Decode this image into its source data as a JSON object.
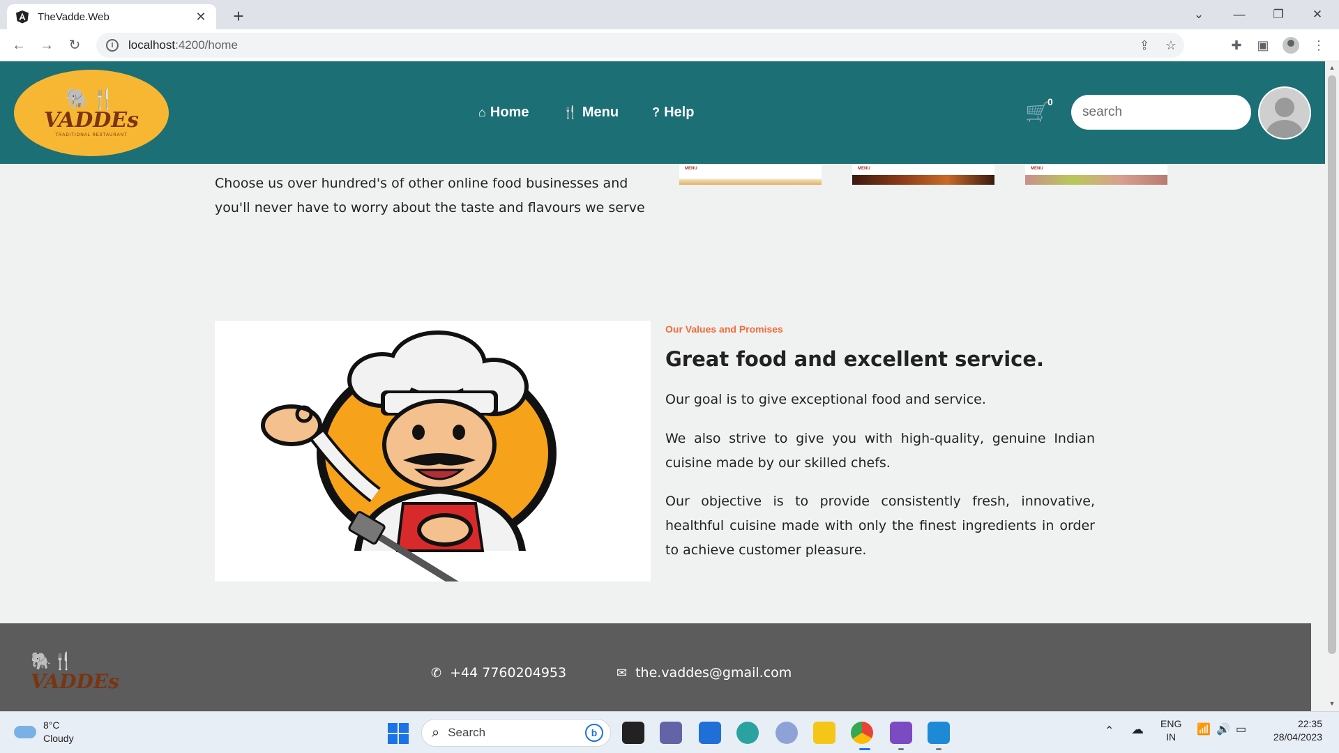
{
  "browser": {
    "tab_title": "TheVadde.Web",
    "tab_close": "✕",
    "new_tab": "+",
    "url_host": "localhost",
    "url_path": ":4200/home",
    "window_controls": [
      "⌄",
      "—",
      "❐",
      "✕"
    ]
  },
  "header": {
    "logo_art": "🐘🍴",
    "logo_text": "VADDEs",
    "logo_sub": "TRADITIONAL RESTAURANT",
    "nav": [
      {
        "label": "Home",
        "icon": "home-icon",
        "glyph": "⌂"
      },
      {
        "label": "Menu",
        "icon": "utensils-icon",
        "glyph": "🍴"
      },
      {
        "label": "Help",
        "icon": "question-icon",
        "glyph": "?"
      }
    ],
    "cart_count": "0",
    "search_placeholder": "search"
  },
  "intro": {
    "text": "Choose us over hundred's of other online food businesses and you'll never have to worry about the taste and flavours we serve",
    "card_labels": [
      "MENU",
      "MENU",
      "MENU"
    ]
  },
  "values": {
    "eyebrow": "Our Values and Promises",
    "title": "Great food and excellent service.",
    "paragraphs": [
      "Our goal is to give exceptional food and service.",
      "We also strive to give you with high-quality, genuine Indian cuisine made by our skilled chefs.",
      "Our objective is to provide consistently fresh, innovative, healthful cuisine made with only the finest ingredients in order to achieve customer pleasure."
    ]
  },
  "footer": {
    "logo_art": "🐘🍴",
    "logo_text": "VADDEs",
    "phone": "+44 7760204953",
    "email": "the.vaddes@gmail.com"
  },
  "taskbar": {
    "temperature": "8°C",
    "condition": "Cloudy",
    "search_label": "Search",
    "language": "ENG",
    "region": "IN",
    "time": "22:35",
    "date": "28/04/2023"
  },
  "colors": {
    "header_bg": "#1b6f75",
    "logo_bg": "#f7b733",
    "accent": "#f26b3a",
    "footer_bg": "#5c5c5c"
  }
}
